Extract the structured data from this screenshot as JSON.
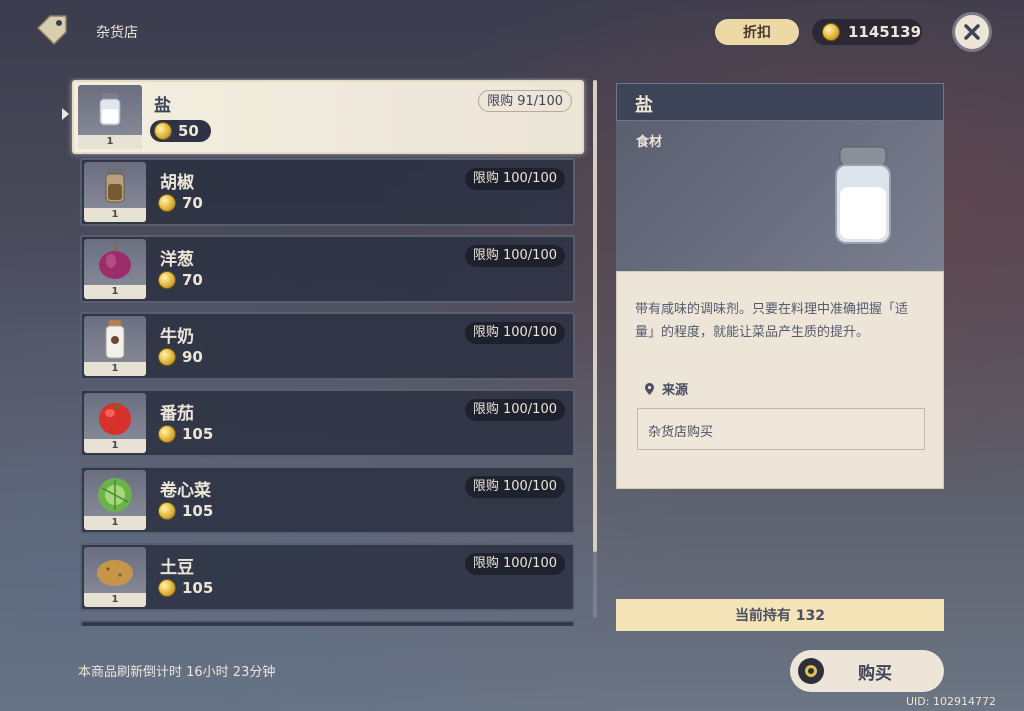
{
  "header": {
    "shop_title": "杂货店",
    "discount_label": "折扣",
    "mora_amount": "1145139"
  },
  "items": [
    {
      "name": "盐",
      "price": "50",
      "limit": "限购 91/100",
      "count": "1",
      "icon": "salt-icon",
      "selected": true
    },
    {
      "name": "胡椒",
      "price": "70",
      "limit": "限购 100/100",
      "count": "1",
      "icon": "pepper-icon"
    },
    {
      "name": "洋葱",
      "price": "70",
      "limit": "限购 100/100",
      "count": "1",
      "icon": "onion-icon"
    },
    {
      "name": "牛奶",
      "price": "90",
      "limit": "限购 100/100",
      "count": "1",
      "icon": "milk-icon"
    },
    {
      "name": "番茄",
      "price": "105",
      "limit": "限购 100/100",
      "count": "1",
      "icon": "tomato-icon"
    },
    {
      "name": "卷心菜",
      "price": "105",
      "limit": "限购 100/100",
      "count": "1",
      "icon": "cabbage-icon"
    },
    {
      "name": "土豆",
      "price": "105",
      "limit": "限购 100/100",
      "count": "1",
      "icon": "potato-icon"
    }
  ],
  "detail": {
    "name": "盐",
    "category": "食材",
    "description": "带有咸味的调味剂。只要在料理中准确把握「适量」的程度，就能让菜品产生质的提升。",
    "source_label": "来源",
    "source_value": "杂货店购买",
    "holding": "当前持有 132"
  },
  "footer": {
    "refresh_text": "本商品刷新倒计时 16小时 23分钟",
    "buy_label": "购买",
    "uid": "UID: 102914772"
  },
  "colors": {
    "panel_cream": "#ece5d8",
    "row_dark": "#2c3242",
    "accent_gold": "#e8c04a",
    "holding_bar": "#f5e4b8"
  }
}
